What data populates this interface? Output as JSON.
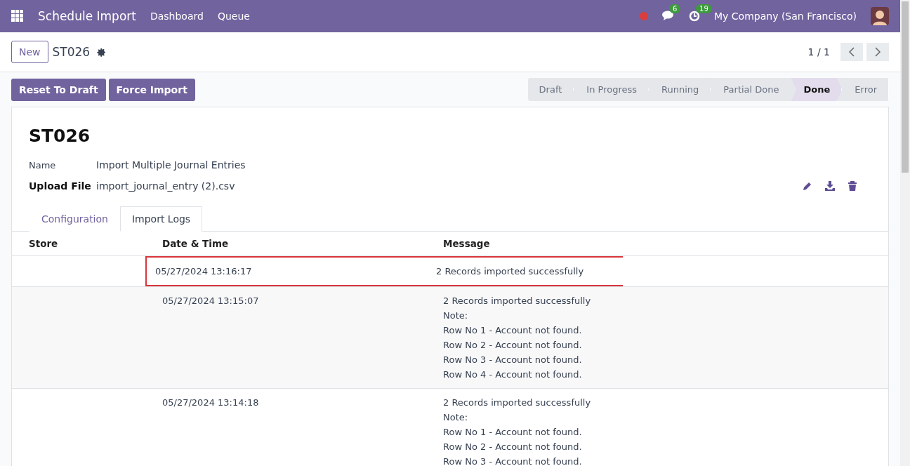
{
  "navbar": {
    "app_title": "Schedule Import",
    "menu": [
      "Dashboard",
      "Queue"
    ],
    "messages_count": "6",
    "activities_count": "19",
    "company": "My Company (San Francisco)"
  },
  "control_panel": {
    "new_button": "New",
    "record": "ST026",
    "pager": "1 / 1"
  },
  "actions": [
    "Reset To Draft",
    "Force Import"
  ],
  "stages": [
    {
      "label": "Draft",
      "selected": false
    },
    {
      "label": "In Progress",
      "selected": false
    },
    {
      "label": "Running",
      "selected": false
    },
    {
      "label": "Partial Done",
      "selected": false
    },
    {
      "label": "Done",
      "selected": true
    },
    {
      "label": "Error",
      "selected": false
    }
  ],
  "form": {
    "title": "ST026",
    "fields": [
      {
        "label": "Name",
        "value": "Import Multiple Journal Entries",
        "bold": false
      },
      {
        "label": "Upload File",
        "value": "import_journal_entry (2).csv",
        "bold": true
      }
    ]
  },
  "tabs": [
    {
      "label": "Configuration",
      "selected": false
    },
    {
      "label": "Import Logs",
      "selected": true
    }
  ],
  "table": {
    "columns": [
      "Store",
      "Date & Time",
      "Message"
    ],
    "rows": [
      {
        "datetime": "05/27/2024 13:16:17",
        "message": [
          "2 Records imported successfully"
        ],
        "highlighted": true
      },
      {
        "datetime": "05/27/2024 13:15:07",
        "message": [
          "2 Records imported successfully",
          "Note:",
          "Row No 1  - Account not found.",
          "Row No 2  - Account not found.",
          "Row No 3  - Account not found.",
          "Row No 4  - Account not found."
        ],
        "highlighted": false
      },
      {
        "datetime": "05/27/2024 13:14:18",
        "message": [
          "2 Records imported successfully",
          "Note:",
          "Row No 1  - Account not found.",
          "Row No 2  - Account not found.",
          "Row No 3  - Account not found."
        ],
        "highlighted": false
      }
    ]
  }
}
